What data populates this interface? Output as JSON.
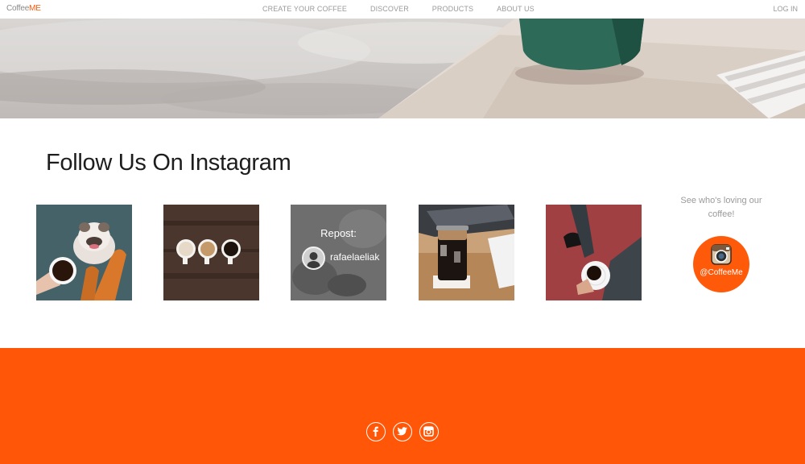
{
  "nav": {
    "logo_main": "Coffee",
    "logo_accent": "ME",
    "links": [
      "CREATE YOUR COFFEE",
      "DISCOVER",
      "PRODUCTS",
      "ABOUT US"
    ],
    "login": "LOG IN",
    "accent_color": "#ff5a0a"
  },
  "instagram": {
    "title": "Follow Us On Instagram",
    "repost_label": "Repost:",
    "repost_user": "rafaelaeliak",
    "side_text": "See who's loving our coffee!",
    "handle": "@CoffeeMe"
  },
  "footer": {
    "background": "#ff5707",
    "social_icons": [
      "facebook-icon",
      "twitter-icon",
      "instagram-icon"
    ]
  }
}
